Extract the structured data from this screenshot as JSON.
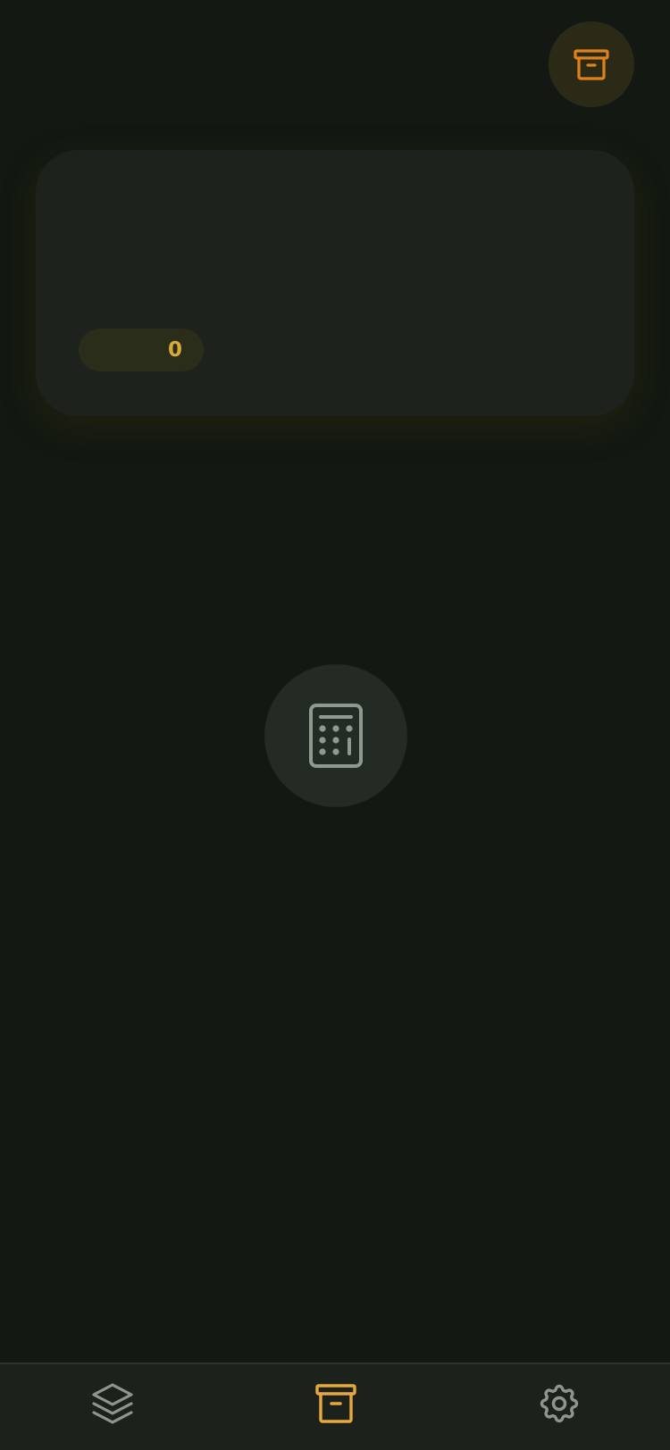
{
  "header": {
    "archive_button_icon": "archive-icon",
    "accent_color": "#e0821c"
  },
  "summary_card": {
    "count": "0",
    "count_color": "#d9a93a"
  },
  "main": {
    "empty_state_icon": "calculator-icon"
  },
  "bottom_nav": {
    "items": [
      {
        "icon": "layers-icon",
        "active": false
      },
      {
        "icon": "archive-icon",
        "active": true
      },
      {
        "icon": "settings-icon",
        "active": false
      }
    ],
    "active_color": "#e6a93c",
    "inactive_color": "#8c968a"
  }
}
